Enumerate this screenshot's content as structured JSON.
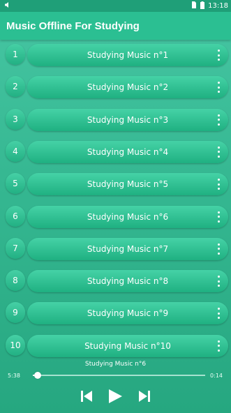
{
  "status_bar": {
    "time": "13:18",
    "icons": [
      "volume-icon",
      "sim-icon",
      "battery-icon"
    ]
  },
  "app_bar": {
    "title": "Music Offline For Studying"
  },
  "tracks": [
    {
      "number": "1",
      "title": "Studying Music n°1"
    },
    {
      "number": "2",
      "title": "Studying Music n°2"
    },
    {
      "number": "3",
      "title": "Studying Music n°3"
    },
    {
      "number": "4",
      "title": "Studying Music n°4"
    },
    {
      "number": "5",
      "title": "Studying Music n°5"
    },
    {
      "number": "6",
      "title": "Studying Music n°6"
    },
    {
      "number": "7",
      "title": "Studying Music n°7"
    },
    {
      "number": "8",
      "title": "Studying Music n°8"
    },
    {
      "number": "9",
      "title": "Studying Music n°9"
    },
    {
      "number": "10",
      "title": "Studying Music n°10"
    }
  ],
  "player": {
    "now_playing": "Studying Music n°6",
    "current_time": "5:38",
    "total_time": "0:14",
    "progress": 0.03
  },
  "colors": {
    "background": "#35b791",
    "app_bar": "#2bbf92",
    "status_bar": "#1f9f78",
    "accent_text": "#ffffff"
  }
}
